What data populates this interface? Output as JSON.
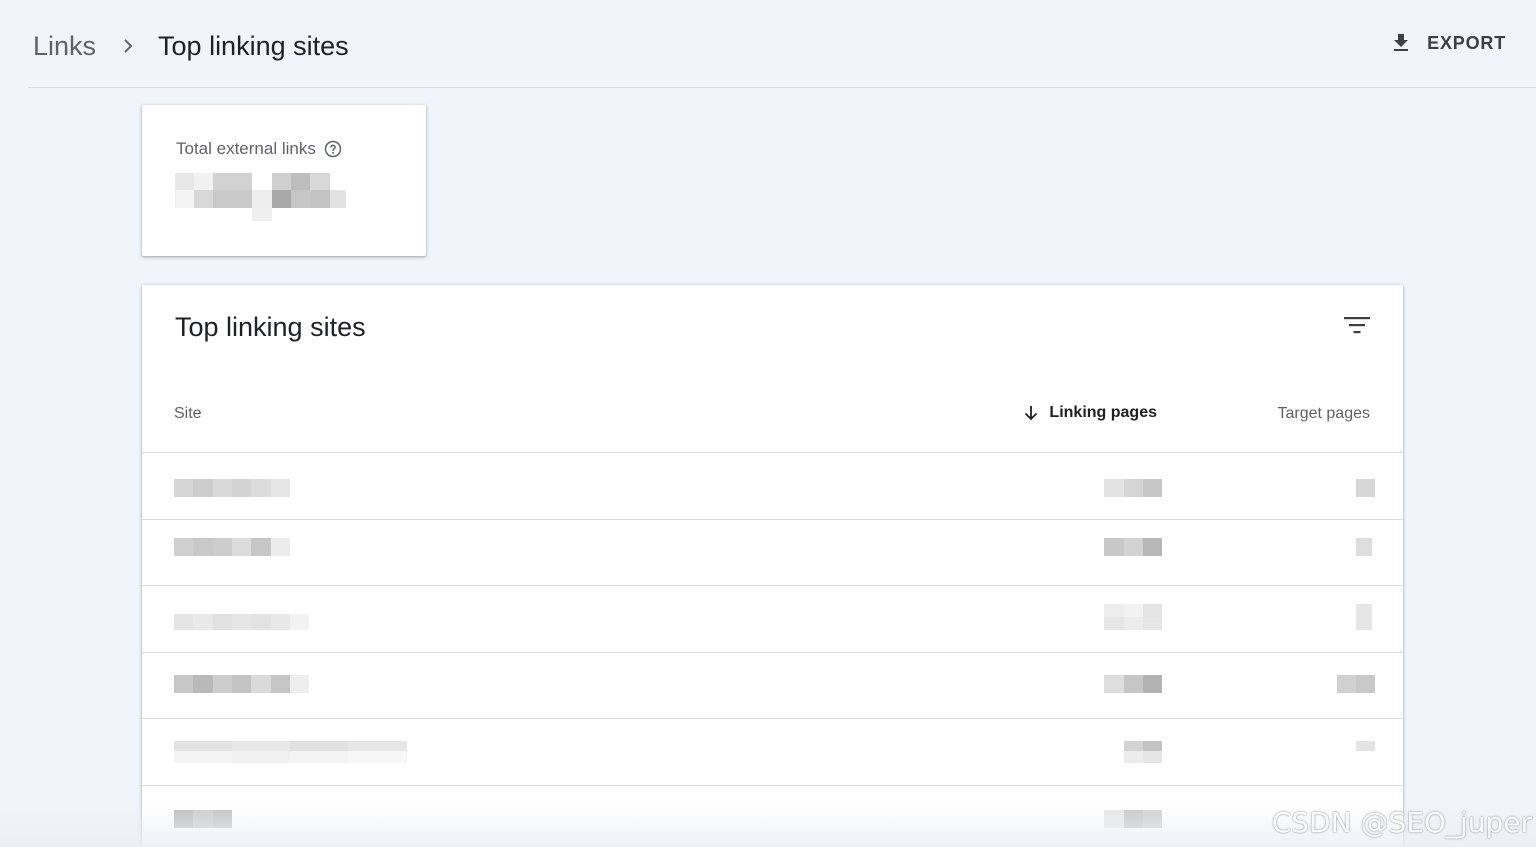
{
  "breadcrumb": {
    "root": "Links",
    "current": "Top linking sites"
  },
  "header": {
    "export_label": "EXPORT"
  },
  "summary": {
    "label": "Total external links"
  },
  "table": {
    "title": "Top linking sites",
    "columns": {
      "site": "Site",
      "linking_pages": "Linking pages",
      "target_pages": "Target pages"
    },
    "sort": {
      "column": "linking_pages",
      "direction": "descending"
    }
  },
  "watermark": "CSDN @SEO_juper",
  "colors": {
    "background": "#f0f4fb",
    "card": "#ffffff",
    "divider": "#dadce0",
    "text_primary": "#202124",
    "text_secondary": "#5f6368"
  }
}
